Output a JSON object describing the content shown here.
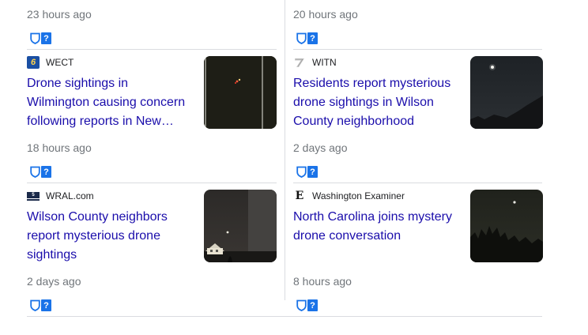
{
  "icons": {
    "shield": "shield-icon",
    "question": "question-icon",
    "question_glyph": "?"
  },
  "colors": {
    "headline": "#1a0dab",
    "meta": "#70757a",
    "badge_blue": "#1a73e8",
    "divider": "#dadce0"
  },
  "top": {
    "left_time": "23 hours ago",
    "right_time": "20 hours ago"
  },
  "articles": [
    {
      "source": "WECT",
      "logo": "wect-logo",
      "title": "Drone sightings in Wilmington causing concern following reports in New…",
      "time": "18 hours ago",
      "thumbnail": "night-sky-drone-lights"
    },
    {
      "source": "WITN",
      "logo": "witn-logo",
      "title": "Residents report mysterious drone sightings in Wilson County neighborhood",
      "time": "2 days ago",
      "thumbnail": "night-sky-single-light"
    },
    {
      "source": "WRAL.com",
      "logo": "wral-logo",
      "title": "Wilson County neighbors report mysterious drone sightings",
      "time": "2 days ago",
      "thumbnail": "night-house-drone"
    },
    {
      "source": "Washington Examiner",
      "logo": "washington-examiner-logo",
      "title": "North Carolina joins mystery drone conversation",
      "time": "8 hours ago",
      "thumbnail": "night-trees-drone"
    }
  ]
}
